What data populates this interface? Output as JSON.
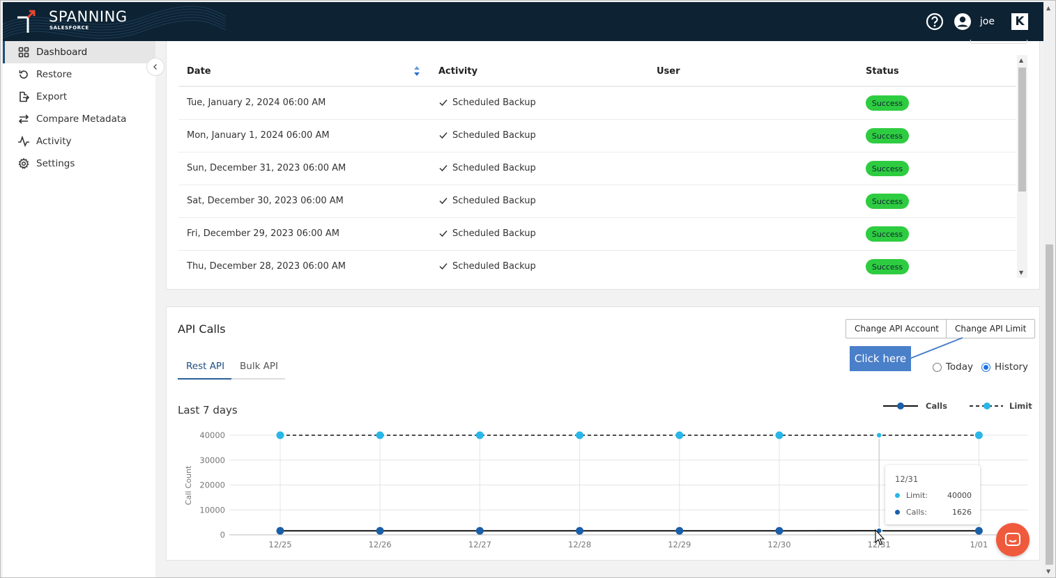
{
  "brand": {
    "name": "SPANNING",
    "sub": "SALESFORCE"
  },
  "header": {
    "user": "joe",
    "help_icon": "help-circle-icon",
    "avatar_icon": "user-circle-icon",
    "app_badge": "K"
  },
  "sidebar": {
    "items": [
      {
        "label": "Dashboard",
        "icon": "grid-icon",
        "active": true
      },
      {
        "label": "Restore",
        "icon": "restore-icon"
      },
      {
        "label": "Export",
        "icon": "export-icon"
      },
      {
        "label": "Compare Metadata",
        "icon": "swap-icon"
      },
      {
        "label": "Activity",
        "icon": "pulse-icon"
      },
      {
        "label": "Settings",
        "icon": "gear-icon"
      }
    ]
  },
  "activity_table": {
    "columns": {
      "date": "Date",
      "activity": "Activity",
      "user": "User",
      "status": "Status"
    },
    "rows": [
      {
        "date": "Tue, January 2, 2024 06:00 AM",
        "activity": "Scheduled Backup",
        "user": "",
        "status": "Success"
      },
      {
        "date": "Mon, January 1, 2024 06:00 AM",
        "activity": "Scheduled Backup",
        "user": "",
        "status": "Success"
      },
      {
        "date": "Sun, December 31, 2023 06:00 AM",
        "activity": "Scheduled Backup",
        "user": "",
        "status": "Success"
      },
      {
        "date": "Sat, December 30, 2023 06:00 AM",
        "activity": "Scheduled Backup",
        "user": "",
        "status": "Success"
      },
      {
        "date": "Fri, December 29, 2023 06:00 AM",
        "activity": "Scheduled Backup",
        "user": "",
        "status": "Success"
      },
      {
        "date": "Thu, December 28, 2023 06:00 AM",
        "activity": "Scheduled Backup",
        "user": "",
        "status": "Success"
      }
    ]
  },
  "api": {
    "title": "API Calls",
    "change_account_label": "Change API Account",
    "change_limit_label": "Change API Limit",
    "callout": "Click here",
    "tabs": [
      {
        "label": "Rest API",
        "active": true
      },
      {
        "label": "Bulk API",
        "active": false
      }
    ],
    "radio_today": "Today",
    "radio_history": "History",
    "selected_range": "History",
    "range_label": "Last 7 days"
  },
  "tooltip": {
    "date": "12/31",
    "limit_label": "Limit:",
    "limit_value": "40000",
    "calls_label": "Calls:",
    "calls_value": "1626"
  },
  "colors": {
    "calls": "#1a5fa8",
    "limit": "#29b6e8",
    "success": "#2ecc40",
    "header": "#0d2233",
    "chat": "#f05a3c"
  },
  "chart_data": {
    "type": "line",
    "x": [
      "12/25",
      "12/26",
      "12/27",
      "12/28",
      "12/29",
      "12/30",
      "12/31",
      "1/01"
    ],
    "series": [
      {
        "name": "Calls",
        "values": [
          1600,
          1600,
          1600,
          1600,
          1600,
          1600,
          1626,
          1600
        ],
        "style": "solid",
        "color": "#1a5fa8"
      },
      {
        "name": "Limit",
        "values": [
          40000,
          40000,
          40000,
          40000,
          40000,
          40000,
          40000,
          40000
        ],
        "style": "dashed",
        "color": "#29b6e8"
      }
    ],
    "ylabel": "Call Count",
    "yticks": [
      0,
      10000,
      20000,
      30000,
      40000
    ],
    "ylim": [
      0,
      40000
    ],
    "legend": "top-right",
    "grid": true
  }
}
